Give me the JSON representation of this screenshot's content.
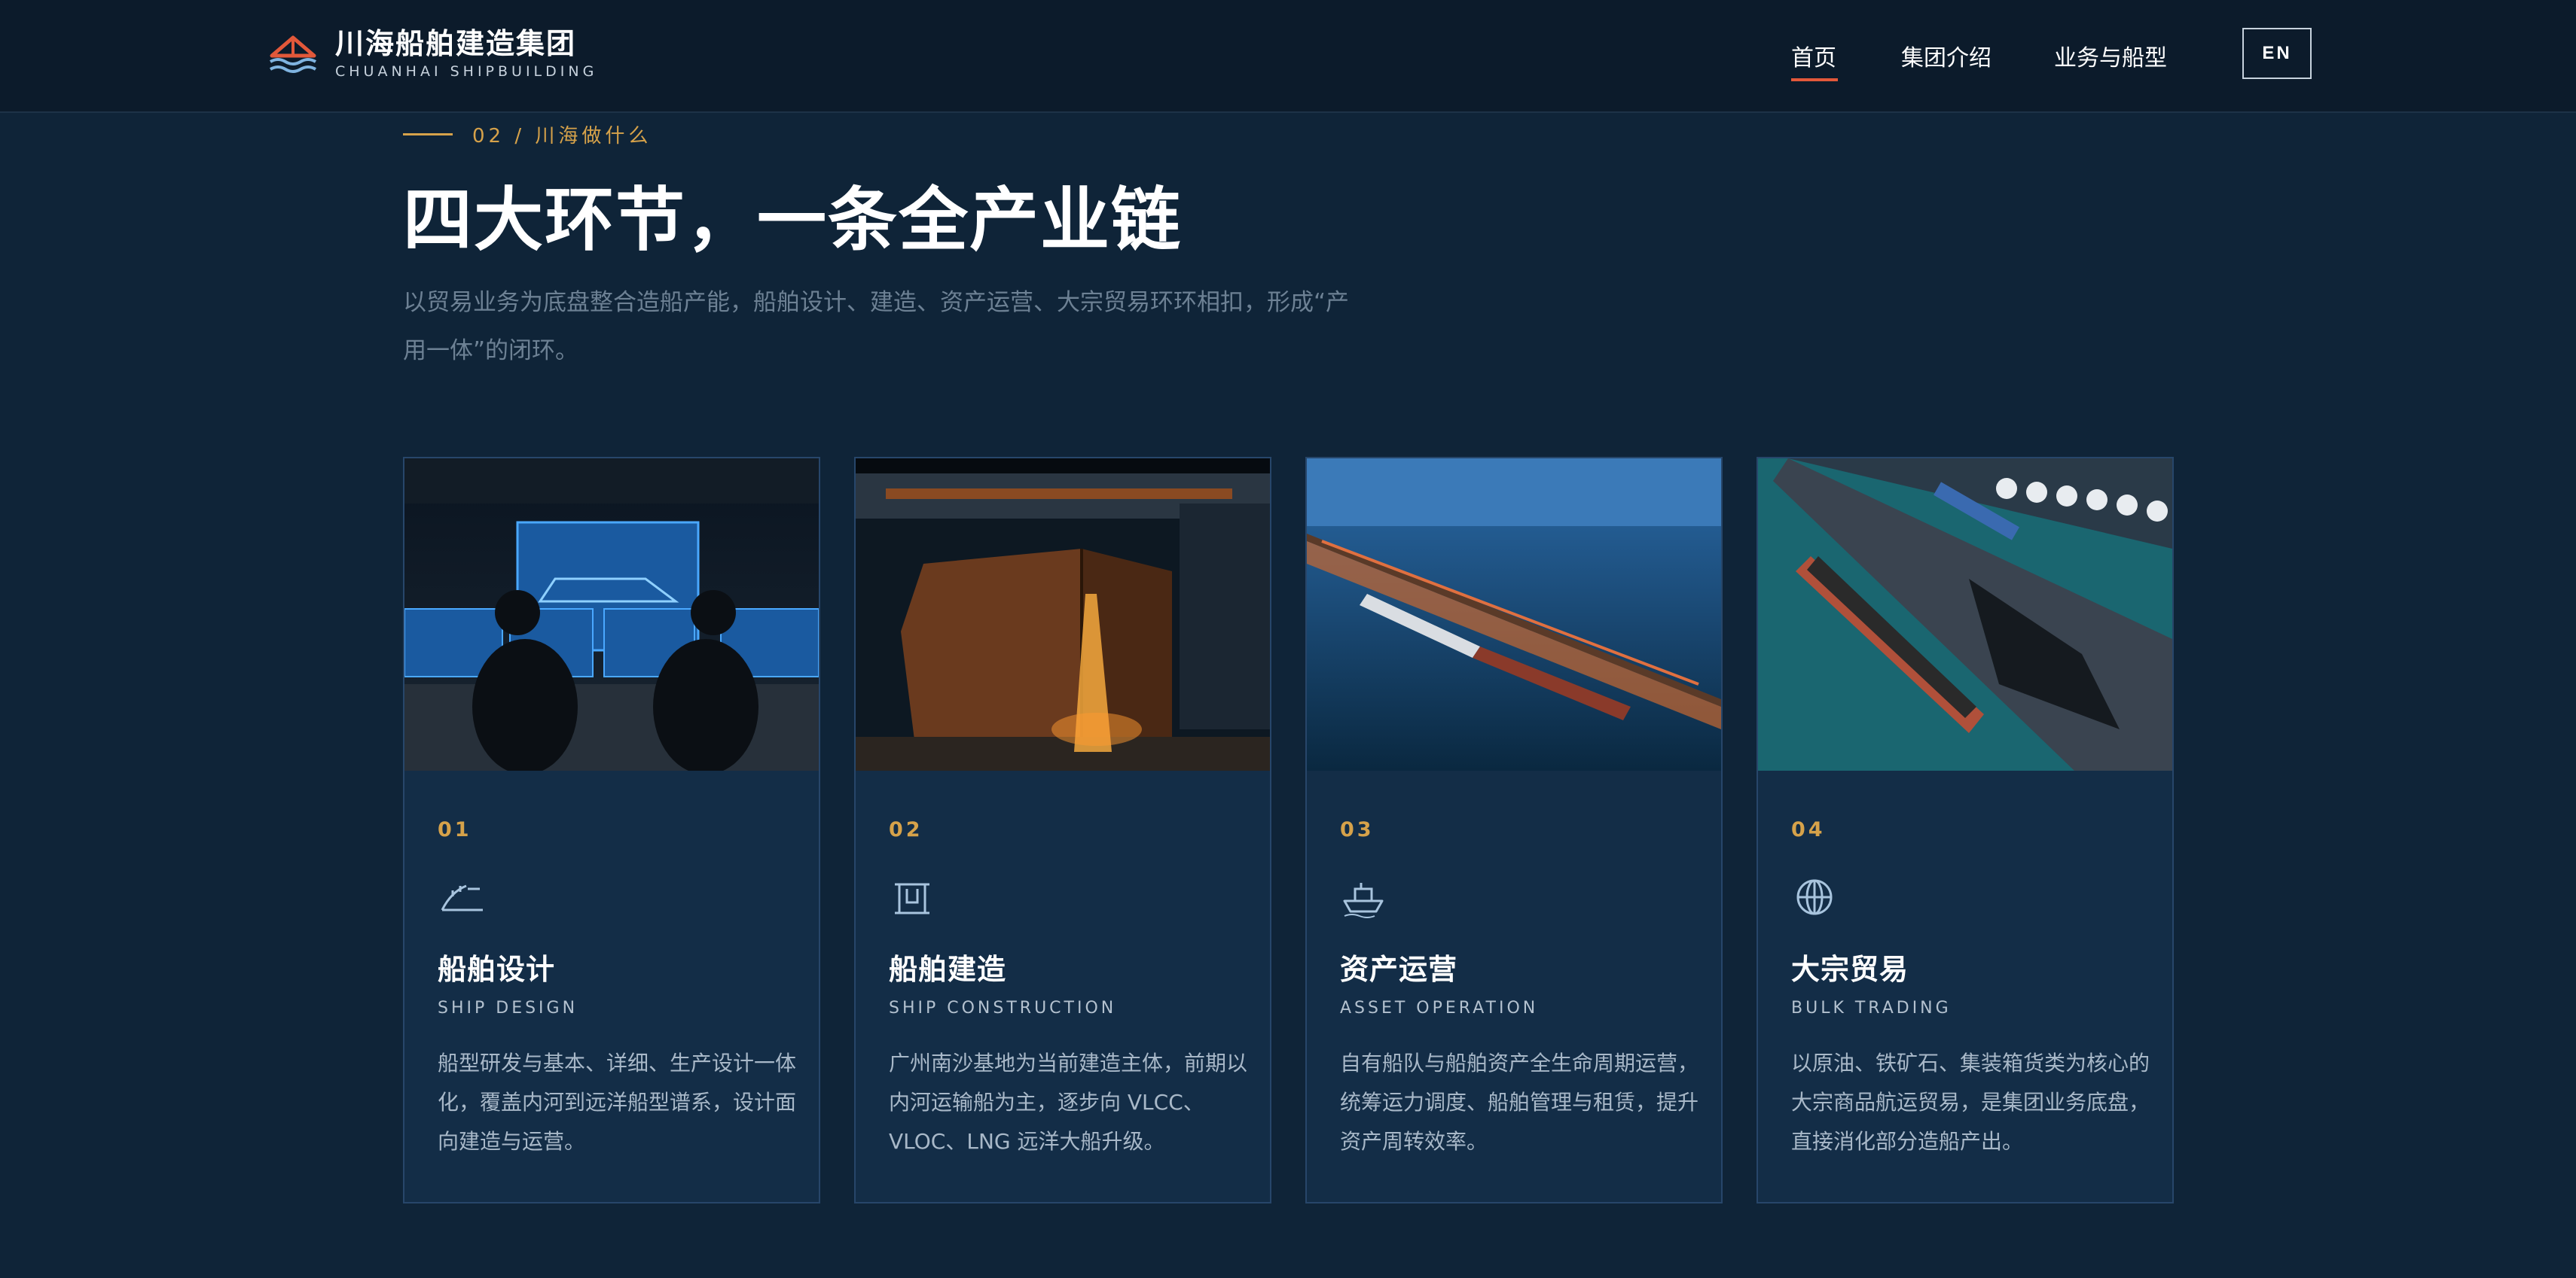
{
  "header": {
    "brand_cn": "川海船舶建造集团",
    "brand_en": "CHUANHAI SHIPBUILDING",
    "nav": [
      {
        "label": "首页",
        "active": true
      },
      {
        "label": "集团介绍",
        "active": false
      },
      {
        "label": "业务与船型",
        "active": false
      }
    ],
    "lang_button": "EN",
    "accent_color": "#e2583a"
  },
  "section": {
    "eyebrow": "02 / 川海做什么",
    "title": "四大环节，一条全产业链",
    "description": "以贸易业务为底盘整合造船产能，船舶设计、建造、资产运营、大宗贸易环环相扣，形成“产用一体”的闭环。"
  },
  "cards": [
    {
      "number": "01",
      "icon": "ship-design-icon",
      "title": "船舶设计",
      "subtitle": "SHIP DESIGN",
      "description": "船型研发与基本、详细、生产设计一体化，覆盖内河到远洋船型谱系，设计面向建造与运营。",
      "image": "design-control-room-photo"
    },
    {
      "number": "02",
      "icon": "gantry-crane-icon",
      "title": "船舶建造",
      "subtitle": "SHIP CONSTRUCTION",
      "description": "广州南沙基地为当前建造主体，前期以内河运输船为主，逐步向 VLCC、VLOC、LNG 远洋大船升级。",
      "image": "shipyard-construction-photo"
    },
    {
      "number": "03",
      "icon": "cargo-ship-icon",
      "title": "资产运营",
      "subtitle": "ASSET OPERATION",
      "description": "自有船队与船舶资产全生命周期运营，统筹运力调度、船舶管理与租赁，提升资产周转效率。",
      "image": "port-terminal-photo"
    },
    {
      "number": "04",
      "icon": "globe-icon",
      "title": "大宗贸易",
      "subtitle": "BULK TRADING",
      "description": "以原油、铁矿石、集装箱货类为核心的大宗商品航运贸易，是集团业务底盘，直接消化部分造船产出。",
      "image": "bulk-port-photo"
    }
  ]
}
